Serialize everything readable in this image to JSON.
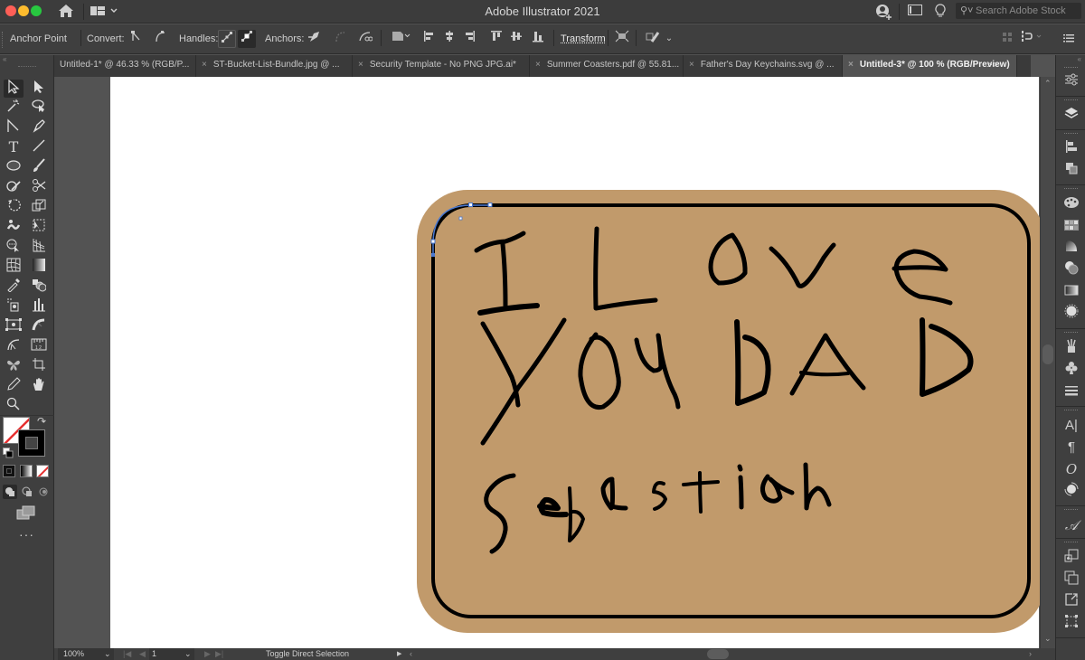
{
  "app": {
    "title": "Adobe Illustrator 2021"
  },
  "titlebar": {
    "icons": [
      "home-icon",
      "workspace-switcher-icon",
      "add-user-icon",
      "panel-toggle-icon",
      "discover-lightbulb-icon"
    ],
    "search": {
      "placeholder": "Search Adobe Stock"
    }
  },
  "control_bar": {
    "tool_label": "Anchor Point",
    "convert_label": "Convert:",
    "handles_label": "Handles:",
    "anchors_label": "Anchors:",
    "transform_label": "Transform"
  },
  "tabs": [
    {
      "label": "Untitled-1* @ 46.33 % (RGB/P...",
      "active": false,
      "closable": false
    },
    {
      "label": "ST-Bucket-List-Bundle.jpg @ ...",
      "active": false,
      "closable": true
    },
    {
      "label": "Security Template - No PNG JPG.ai*",
      "active": false,
      "closable": true
    },
    {
      "label": "Summer Coasters.pdf @ 55.81...",
      "active": false,
      "closable": true
    },
    {
      "label": "Father's Day Keychains.svg @ ...",
      "active": false,
      "closable": true
    },
    {
      "label": "Untitled-3* @ 100 % (RGB/Preview)",
      "active": true,
      "closable": true
    }
  ],
  "tab_overflow": ">>",
  "tools": [
    "selection-tool",
    "direct-selection-tool",
    "magic-wand-tool",
    "lasso-tool",
    "pen-anchor-tool",
    "curvature-tool",
    "type-tool",
    "line-segment-tool",
    "ellipse-tool",
    "paintbrush-tool",
    "shaper-tool",
    "scissors-tool",
    "rotate-tool",
    "scale-tool",
    "puppet-warp-tool",
    "free-transform-tool",
    "shape-builder-tool",
    "perspective-grid-tool",
    "mesh-tool",
    "gradient-tool",
    "eyedropper-tool",
    "blend-tool",
    "symbol-sprayer-tool",
    "column-graph-tool",
    "artboard-tool",
    "slice-tool",
    "width-tool",
    "ruler-tool",
    "symbolism-tool",
    "crop-tool",
    "pencil-tool",
    "hand-tool",
    "zoom-tool"
  ],
  "colors": {
    "fill": "none",
    "stroke": "#000000",
    "sign_fill": "#c19a6b",
    "sign_stroke": "#000000",
    "selection_accent": "#4a78d0",
    "app_dark": "#3f3f3f",
    "canvas_bg": "#535353"
  },
  "artwork": {
    "lines": [
      "I Love",
      "YOU DAD",
      "Sebastian"
    ]
  },
  "dock_panels": [
    "properties-icon",
    "layers-icon",
    "align-icon",
    "pathfinder-icon",
    "color-icon",
    "swatches-icon",
    "color-guide-icon",
    "transparency-icon",
    "gradient-icon",
    "appearance-icon",
    "brushes-icon",
    "symbols-icon",
    "stroke-icon",
    "character-icon",
    "paragraph-icon",
    "opentype-icon",
    "glyphs-icon",
    "char-styles-icon",
    "asset-export-icon",
    "artboards-icon",
    "links-icon",
    "transform-icon"
  ],
  "status": {
    "zoom": "100%",
    "artboard_number": "1",
    "current_tool": "Toggle Direct Selection"
  }
}
